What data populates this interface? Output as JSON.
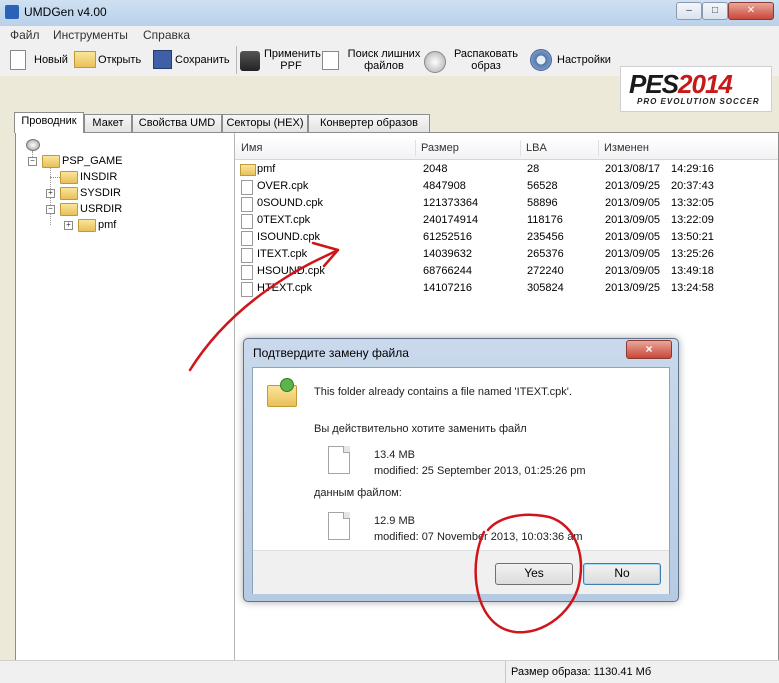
{
  "window": {
    "title": "UMDGen v4.00"
  },
  "menu": [
    "Файл",
    "Инструменты",
    "Справка"
  ],
  "toolbar": {
    "new": "Новый",
    "open": "Открыть",
    "save": "Сохранить",
    "apply_ppf_1": "Применить",
    "apply_ppf_2": "PPF",
    "find_extra_1": "Поиск лишних",
    "find_extra_2": "файлов",
    "unpack_1": "Распаковать",
    "unpack_2": "образ",
    "settings": "Настройки"
  },
  "logo": {
    "main": "PES",
    "num": "2014",
    "sub": "PRO EVOLUTION SOCCER"
  },
  "tabs": [
    "Проводник",
    "Макет",
    "Свойства UMD",
    "Секторы (HEX)",
    "Конвертер образов"
  ],
  "tree": {
    "root": "PSP_GAME",
    "children": [
      "INSDIR",
      "SYSDIR",
      "USRDIR"
    ],
    "sub": "pmf"
  },
  "list": {
    "columns": [
      "Имя",
      "Размер",
      "LBA",
      "Изменен"
    ],
    "rows": [
      {
        "name": "pmf",
        "size": "2048",
        "lba": "28",
        "date": "2013/08/17",
        "time": "14:29:16",
        "folder": true
      },
      {
        "name": "OVER.cpk",
        "size": "4847908",
        "lba": "56528",
        "date": "2013/09/25",
        "time": "20:37:43"
      },
      {
        "name": "0SOUND.cpk",
        "size": "121373364",
        "lba": "58896",
        "date": "2013/09/05",
        "time": "13:32:05"
      },
      {
        "name": "0TEXT.cpk",
        "size": "240174914",
        "lba": "118176",
        "date": "2013/09/05",
        "time": "13:22:09"
      },
      {
        "name": "ISOUND.cpk",
        "size": "61252516",
        "lba": "235456",
        "date": "2013/09/05",
        "time": "13:50:21"
      },
      {
        "name": "ITEXT.cpk",
        "size": "14039632",
        "lba": "265376",
        "date": "2013/09/05",
        "time": "13:25:26"
      },
      {
        "name": "HSOUND.cpk",
        "size": "68766244",
        "lba": "272240",
        "date": "2013/09/05",
        "time": "13:49:18"
      },
      {
        "name": "HTEXT.cpk",
        "size": "14107216",
        "lba": "305824",
        "date": "2013/09/25",
        "time": "13:24:58"
      }
    ]
  },
  "status": {
    "image_size": "Размер образа: 1130.41 Мб"
  },
  "dialog": {
    "title": "Подтвердите замену файла",
    "message": "This folder already contains a file named 'ITEXT.cpk'.",
    "question": "Вы действительно хотите заменить файл",
    "existing_size": "13.4 MB",
    "existing_modified": "modified: 25 September 2013, 01:25:26 pm",
    "with_file": "данным файлом:",
    "new_size": "12.9 MB",
    "new_modified": "modified: 07 November 2013, 10:03:36 am",
    "yes": "Yes",
    "no": "No",
    "close_glyph": "×"
  },
  "colors": {
    "annotation": "#d0141a",
    "dialog_frame": "#b6cbe3",
    "accent_red": "#c81818"
  }
}
